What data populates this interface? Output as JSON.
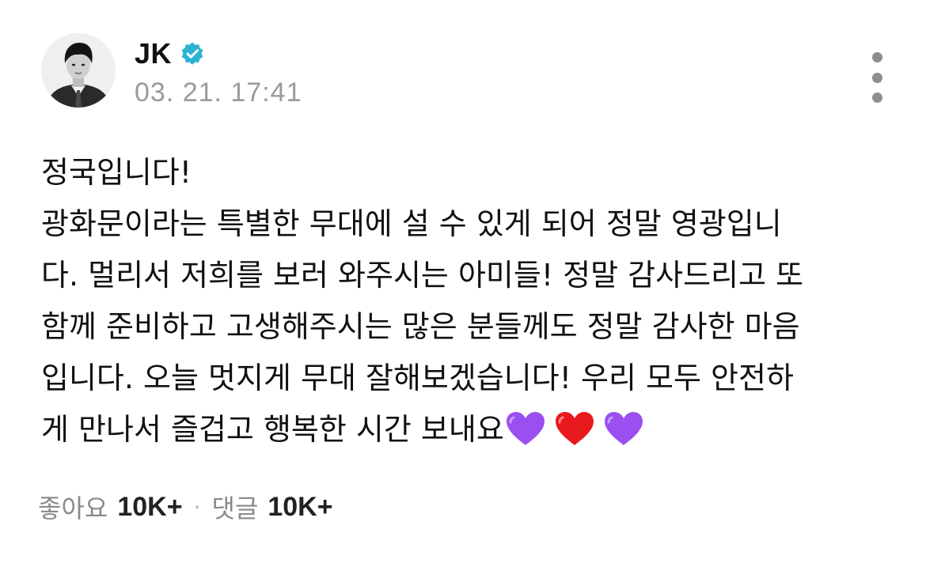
{
  "post": {
    "author": {
      "name": "JK",
      "verified": true,
      "verified_color": "#2bb3d3"
    },
    "timestamp": "03. 21. 17:41",
    "content_lines": [
      "정국입니다!",
      "광화문이라는 특별한 무대에 설 수 있게 되어 정말 영광입니",
      "다. 멀리서 저희를 보러 와주시는 아미들! 정말 감사드리고 또",
      "함께 준비하고 고생해주시는 많은 분들께도 정말 감사한 마음",
      "입니다. 오늘 멋지게 무대 잘해보겠습니다! 우리 모두 안전하",
      "게 만나서 즐겁고 행복한 시간 보내요"
    ],
    "emojis": [
      {
        "name": "purple-heart",
        "color": "#9b4ff0"
      },
      {
        "name": "red-heart",
        "color": "#e8191c"
      },
      {
        "name": "purple-heart",
        "color": "#9b4ff0"
      }
    ],
    "footer": {
      "likes_label": "좋아요",
      "likes_count": "10K+",
      "separator": "·",
      "comments_label": "댓글",
      "comments_count": "10K+"
    }
  }
}
